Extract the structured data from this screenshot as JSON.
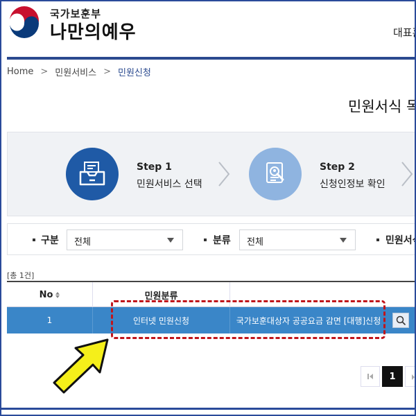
{
  "header": {
    "org_name": "국가보훈부",
    "site_name": "나만의예우",
    "right_link": "대표홈"
  },
  "breadcrumb": {
    "home": "Home",
    "level1": "민원서비스",
    "level2": "민원신청"
  },
  "page_title": "민원서식 목록",
  "steps": [
    {
      "title": "Step 1",
      "desc": "민원서비스 선택",
      "icon": "folder-tray-icon",
      "state": "active"
    },
    {
      "title": "Step 2",
      "desc": "신청인정보 확인",
      "icon": "document-search-icon",
      "state": "inactive"
    }
  ],
  "filter": {
    "category_label": "구분",
    "category_value": "전체",
    "type_label": "분류",
    "type_value": "전체",
    "form_label": "민원서식"
  },
  "count_text": "[총 1건]",
  "table": {
    "headers": [
      "No",
      "민원분류"
    ],
    "rows": [
      {
        "no": "1",
        "category": "인터넷 민원신청",
        "title": "국가보훈대상자 공공요금 감면 [대행]신청"
      }
    ]
  },
  "pagination": {
    "current": "1"
  },
  "colors": {
    "brand_navy": "#2b4a8f",
    "step_active": "#1f5aa6",
    "step_inactive": "#8fb4e0",
    "row_selected": "#3a86c8",
    "highlight": "#c0151b",
    "pointer_arrow": "#f5ef1a"
  }
}
